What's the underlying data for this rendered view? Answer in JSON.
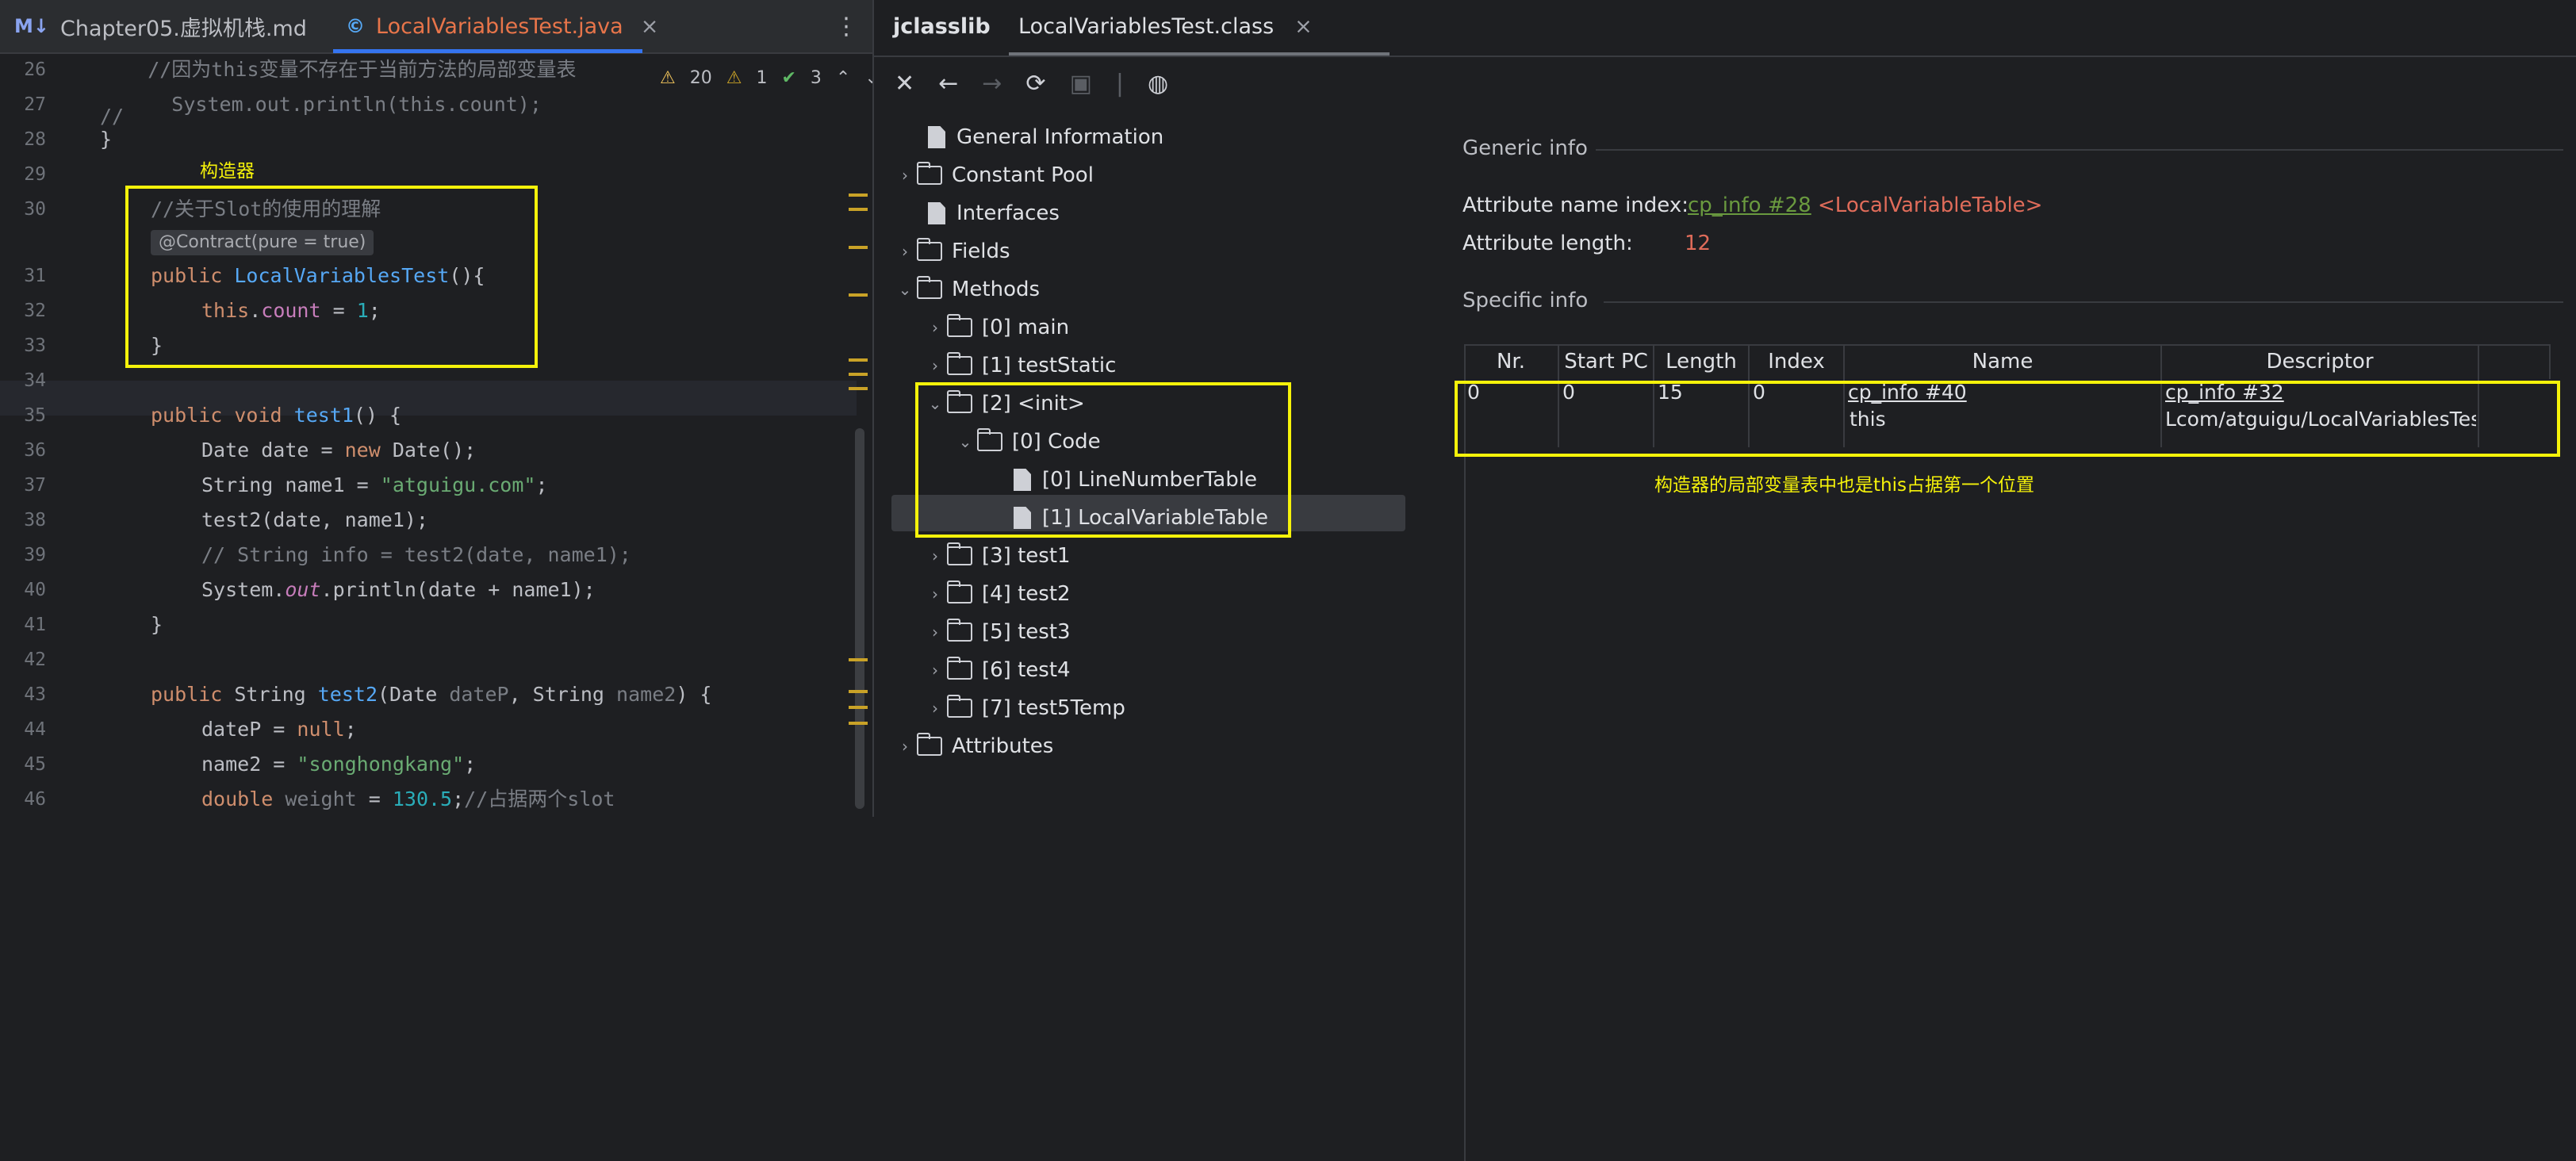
{
  "editor": {
    "tabs": [
      {
        "icon": "M↓",
        "label": "Chapter05.虚拟机栈.md"
      },
      {
        "icon": "©",
        "label": "LocalVariablesTest.java",
        "close": "×"
      }
    ],
    "more": "⋮",
    "inspections": {
      "warnings": "20",
      "weak_warnings": "1",
      "ok": "3"
    },
    "constructor_label": "构造器",
    "contract_hint": "@Contract(pure = true)",
    "lines": [
      {
        "n": "26",
        "text": "        //因为this变量不存在于当前方法的局部变量表"
      },
      {
        "n": "27",
        "text": "//          System.out.println(this.count);"
      },
      {
        "n": "28",
        "text": "    }"
      },
      {
        "n": "29",
        "text": ""
      },
      {
        "n": "30",
        "text": "    //关于Slot的使用的理解"
      },
      {
        "n": "31",
        "text": "    public LocalVariablesTest(){"
      },
      {
        "n": "32",
        "text": "        this.count = 1;"
      },
      {
        "n": "33",
        "text": "    }"
      },
      {
        "n": "34",
        "text": ""
      },
      {
        "n": "35",
        "text": "    public void test1() {"
      },
      {
        "n": "36",
        "text": "        Date date = new Date();"
      },
      {
        "n": "37",
        "text": "        String name1 = \"atguigu.com\";"
      },
      {
        "n": "38",
        "text": "        test2(date, name1);"
      },
      {
        "n": "39",
        "text": "        // String info = test2(date, name1);"
      },
      {
        "n": "40",
        "text": "        System.out.println(date + name1);"
      },
      {
        "n": "41",
        "text": "    }"
      },
      {
        "n": "42",
        "text": ""
      },
      {
        "n": "43",
        "text": "    public String test2(Date dateP, String name2) {"
      },
      {
        "n": "44",
        "text": "        dateP = null;"
      },
      {
        "n": "45",
        "text": "        name2 = \"songhongkang\";"
      },
      {
        "n": "46",
        "text": "        double weight = 130.5;//占据两个slot"
      }
    ]
  },
  "jclasslib": {
    "tabs": [
      {
        "label": "jclasslib"
      },
      {
        "label": "LocalVariablesTest.class",
        "close": "×"
      }
    ],
    "tree": [
      {
        "label": "General Information",
        "type": "file"
      },
      {
        "label": "Constant Pool",
        "type": "folder"
      },
      {
        "label": "Interfaces",
        "type": "file"
      },
      {
        "label": "Fields",
        "type": "folder"
      },
      {
        "label": "Methods",
        "type": "folder"
      },
      {
        "label": "[0] main",
        "type": "folder"
      },
      {
        "label": "[1] testStatic",
        "type": "folder"
      },
      {
        "label": "[2] <init>",
        "type": "folder"
      },
      {
        "label": "[0] Code",
        "type": "folder"
      },
      {
        "label": "[0] LineNumberTable",
        "type": "file"
      },
      {
        "label": "[1] LocalVariableTable",
        "type": "file"
      },
      {
        "label": "[3] test1",
        "type": "folder"
      },
      {
        "label": "[4] test2",
        "type": "folder"
      },
      {
        "label": "[5] test3",
        "type": "folder"
      },
      {
        "label": "[6] test4",
        "type": "folder"
      },
      {
        "label": "[7] test5Temp",
        "type": "folder"
      },
      {
        "label": "Attributes",
        "type": "folder"
      }
    ],
    "generic_info": {
      "title": "Generic info",
      "name_index_label": "Attribute name index:",
      "name_index_link": "cp_info #28",
      "name_index_value": "<LocalVariableTable>",
      "length_label": "Attribute length:",
      "length_value": "12"
    },
    "specific_info": {
      "title": "Specific info",
      "columns": [
        "Nr.",
        "Start PC",
        "Length",
        "Index",
        "Name",
        "Descriptor"
      ],
      "rows": [
        {
          "nr": "0",
          "start_pc": "0",
          "length": "15",
          "index": "0",
          "name_link": "cp_info #40",
          "name": "this",
          "desc_link": "cp_info #32",
          "desc": "Lcom/atguigu/LocalVariablesTest;"
        }
      ]
    },
    "annotation": "构造器的局部变量表中也是this占据第一个位置"
  }
}
